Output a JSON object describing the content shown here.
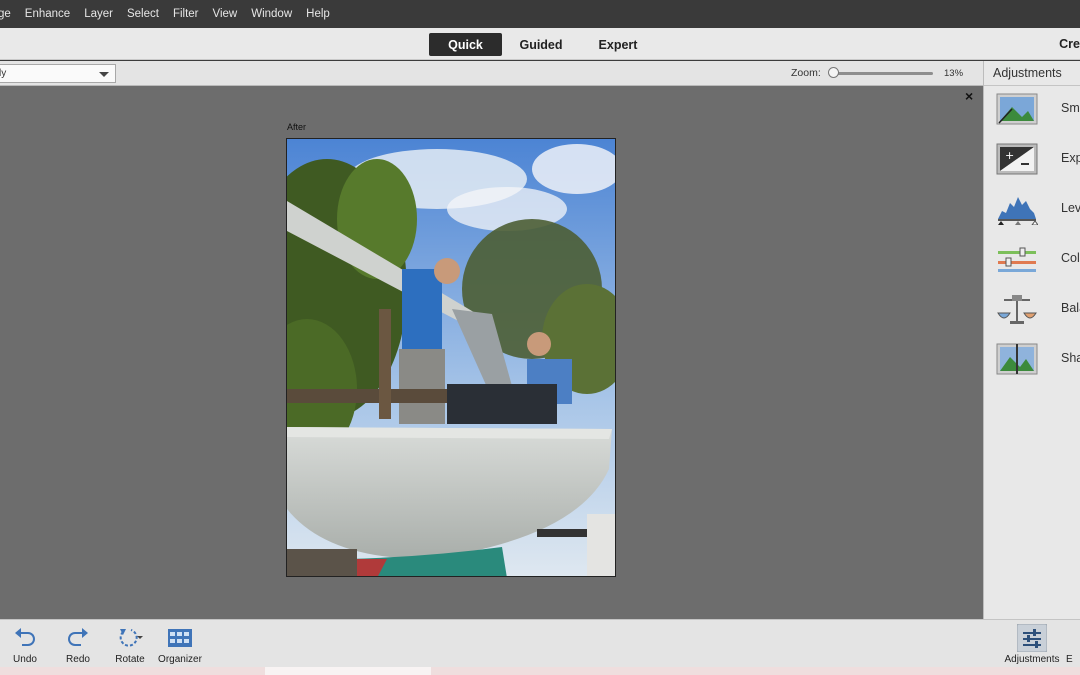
{
  "menu": [
    "ge",
    "Enhance",
    "Layer",
    "Select",
    "Filter",
    "View",
    "Window",
    "Help"
  ],
  "modes": {
    "quick": "Quick",
    "guided": "Guided",
    "expert": "Expert",
    "active": "Quick",
    "create": "Cre"
  },
  "options": {
    "view_value": "ly",
    "zoom_label": "Zoom:",
    "zoom_value": "13%",
    "zoom_level": 0.13
  },
  "canvas": {
    "close": "×",
    "after_label": "After"
  },
  "adjustments": {
    "title": "Adjustments",
    "items": [
      {
        "label": "Sma",
        "icon": "smart-fix-icon"
      },
      {
        "label": "Exp",
        "icon": "exposure-icon"
      },
      {
        "label": "Lev",
        "icon": "levels-icon"
      },
      {
        "label": "Colo",
        "icon": "color-icon"
      },
      {
        "label": "Bala",
        "icon": "balance-icon"
      },
      {
        "label": "Sha",
        "icon": "sharpen-icon"
      }
    ]
  },
  "bottom": {
    "undo": "Undo",
    "redo": "Redo",
    "rotate": "Rotate",
    "organizer": "Organizer",
    "adjustments": "Adjustments",
    "effects_partial": "E"
  },
  "colors": {
    "accent_active": "#2c2c2c",
    "canvas_bg": "#6d6d6d",
    "panel_bg": "#e8e8e8",
    "icon_blue": "#3f74b8"
  }
}
